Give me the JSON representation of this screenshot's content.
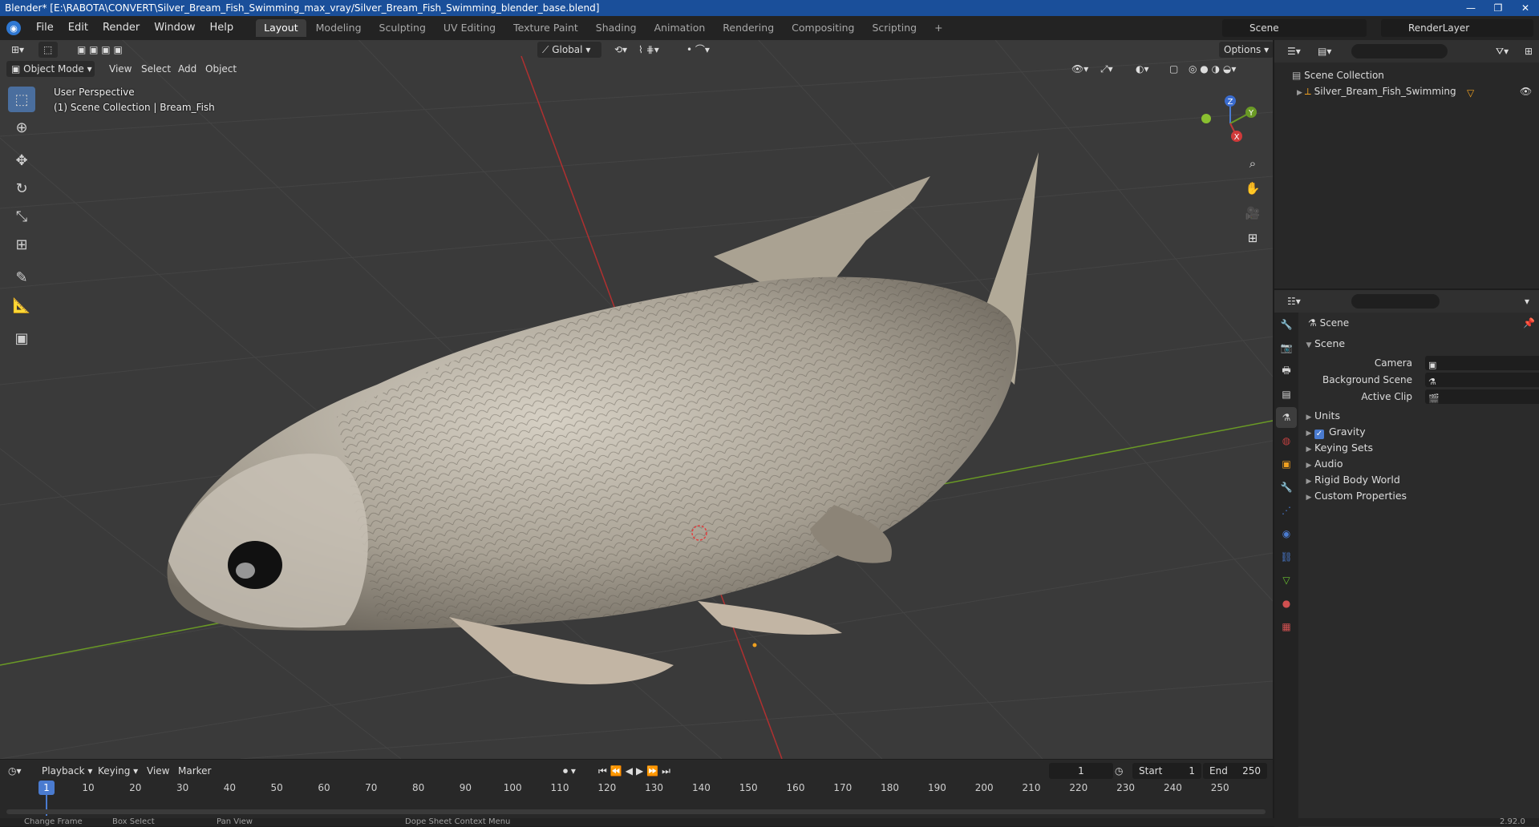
{
  "window": {
    "title": "Blender* [E:\\RABOTA\\CONVERT\\Silver_Bream_Fish_Swimming_max_vray/Silver_Bream_Fish_Swimming_blender_base.blend]",
    "min": "—",
    "max": "❐",
    "close": "✕"
  },
  "menu": [
    "File",
    "Edit",
    "Render",
    "Window",
    "Help"
  ],
  "workspaces": [
    "Layout",
    "Modeling",
    "Sculpting",
    "UV Editing",
    "Texture Paint",
    "Shading",
    "Animation",
    "Rendering",
    "Compositing",
    "Scripting"
  ],
  "workspace_add": "+",
  "scene": {
    "name": "Scene",
    "view_layer": "RenderLayer"
  },
  "viewport": {
    "transform_orientation": "Global",
    "options": "Options",
    "mode": "Object Mode",
    "header_menus": [
      "View",
      "Select",
      "Add",
      "Object"
    ],
    "perspective": "User Perspective",
    "collection_info": "(1) Scene Collection | Bream_Fish",
    "gizmo": {
      "z": "Z",
      "y": "Y",
      "x": "X"
    },
    "background_color": "#3a3a3a",
    "fish_body_color": "#b9b2a5"
  },
  "outliner": {
    "root": "Scene Collection",
    "items": [
      {
        "name": "Silver_Bream_Fish_Swimming"
      }
    ]
  },
  "properties": {
    "context": "Scene",
    "panel": "Scene",
    "fields": [
      {
        "label": "Camera"
      },
      {
        "label": "Background Scene"
      },
      {
        "label": "Active Clip"
      }
    ],
    "subpanels": [
      "Units",
      "Gravity",
      "Keying Sets",
      "Audio",
      "Rigid Body World",
      "Custom Properties"
    ],
    "gravity_checked": true
  },
  "timeline": {
    "menus": [
      "Playback",
      "Keying",
      "View",
      "Marker"
    ],
    "current_frame": "1",
    "start_label": "Start",
    "start": "1",
    "end_label": "End",
    "end": "250",
    "ticks": [
      "1",
      "10",
      "20",
      "30",
      "40",
      "50",
      "60",
      "70",
      "80",
      "90",
      "100",
      "110",
      "120",
      "130",
      "140",
      "150",
      "160",
      "170",
      "180",
      "190",
      "200",
      "210",
      "220",
      "230",
      "240",
      "250"
    ]
  },
  "statusbar": {
    "items": [
      "Change Frame",
      "Box Select",
      "Pan View",
      "Dope Sheet Context Menu"
    ],
    "version": "2.92.0"
  },
  "colors": {
    "accent": "#4a7bd0",
    "active_tool": "#4a6e9e",
    "x_axis": "#b03030",
    "y_axis": "#6a9a25"
  }
}
